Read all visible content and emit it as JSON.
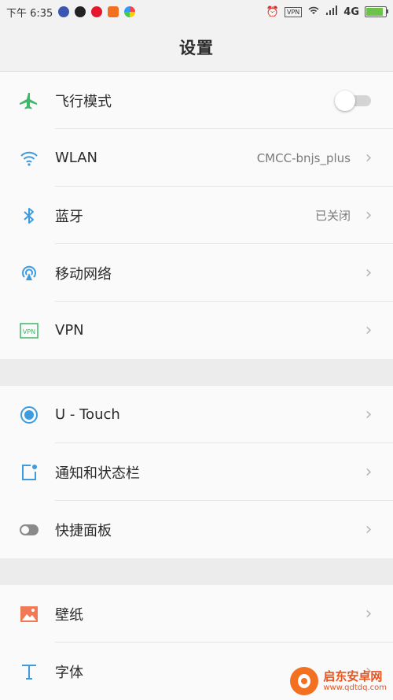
{
  "status_bar": {
    "time": "下午 6:35",
    "network": "4G",
    "vpn": "VPN"
  },
  "header": {
    "title": "设置"
  },
  "groups": [
    {
      "items": [
        {
          "label": "飞行模式",
          "icon": "airplane-icon",
          "control": "toggle",
          "toggle_on": false
        },
        {
          "label": "WLAN",
          "icon": "wifi-icon",
          "value": "CMCC-bnjs_plus"
        },
        {
          "label": "蓝牙",
          "icon": "bluetooth-icon",
          "value": "已关闭"
        },
        {
          "label": "移动网络",
          "icon": "mobile-network-icon"
        },
        {
          "label": "VPN",
          "icon": "vpn-icon"
        }
      ]
    },
    {
      "items": [
        {
          "label": "U - Touch",
          "icon": "u-touch-icon"
        },
        {
          "label": "通知和状态栏",
          "icon": "notification-icon"
        },
        {
          "label": "快捷面板",
          "icon": "quick-panel-icon"
        }
      ]
    },
    {
      "items": [
        {
          "label": "壁纸",
          "icon": "wallpaper-icon"
        },
        {
          "label": "字体",
          "icon": "font-icon"
        }
      ]
    }
  ],
  "colors": {
    "airplane": "#3fb86a",
    "blue": "#3d9be0",
    "vpn": "#3fb86a",
    "wallpaper": "#f07a55",
    "grey_icon": "#8a8a8a"
  },
  "watermark": {
    "title": "启东安卓网",
    "url": "www.qdtdq.com"
  }
}
